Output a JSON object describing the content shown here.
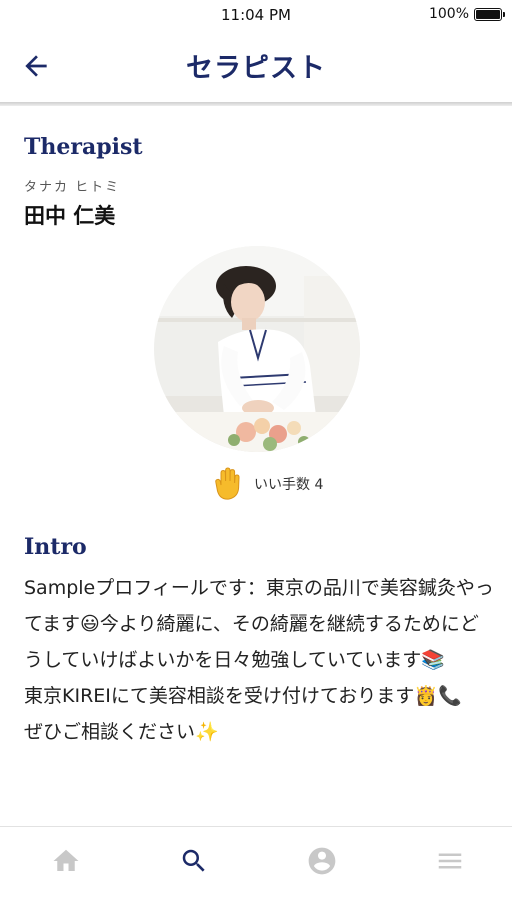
{
  "status_bar": {
    "time": "11:04 PM",
    "battery": "100%"
  },
  "header": {
    "title": "セラピスト",
    "back_icon": "arrow-left-icon"
  },
  "therapist": {
    "heading": "Therapist",
    "kana": "タナカ ヒトミ",
    "name": "田中 仁美",
    "photo": "therapist-photo"
  },
  "likes": {
    "label": "いい手数 4",
    "icon": "raised-hand-icon"
  },
  "intro": {
    "heading": "Intro",
    "text": "Sampleプロフィールです：東京の品川で美容鍼灸やってます😃今より綺麗に、その綺麗を継続するためにどうしていけばよいかを日々勉強していています📚\n東京KIREIにて美容相談を受け付けております👸📞\nぜひご相談ください✨"
  },
  "tab_bar": {
    "tabs": [
      {
        "name": "home",
        "icon": "home-icon",
        "active": false
      },
      {
        "name": "search",
        "icon": "search-icon",
        "active": true
      },
      {
        "name": "account",
        "icon": "account-icon",
        "active": false
      },
      {
        "name": "menu",
        "icon": "menu-icon",
        "active": false
      }
    ],
    "active_color": "#1c2a68",
    "inactive_color": "#c8c8c8"
  },
  "colors": {
    "brand": "#1c2a68"
  }
}
